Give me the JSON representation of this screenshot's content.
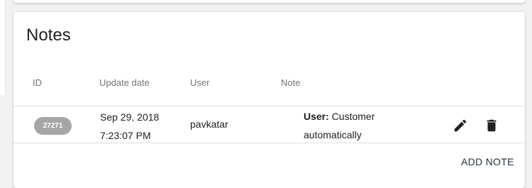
{
  "card": {
    "title": "Notes"
  },
  "table": {
    "columns": [
      "ID",
      "Update date",
      "User",
      "Note"
    ],
    "rows": [
      {
        "id": "27271",
        "date_line1": "Sep 29, 2018",
        "date_line2": "7:23:07 PM",
        "user": "pavkatar",
        "note_label": "User:",
        "note_line1_rest": " Customer",
        "note_line2": "automatically"
      }
    ]
  },
  "actions": {
    "edit_icon": "pencil-icon",
    "delete_icon": "trash-icon",
    "add_note_label": "ADD NOTE"
  },
  "colors": {
    "chip_background": "#a6a6a6",
    "icon_color": "#212121",
    "header_text": "#757575"
  }
}
